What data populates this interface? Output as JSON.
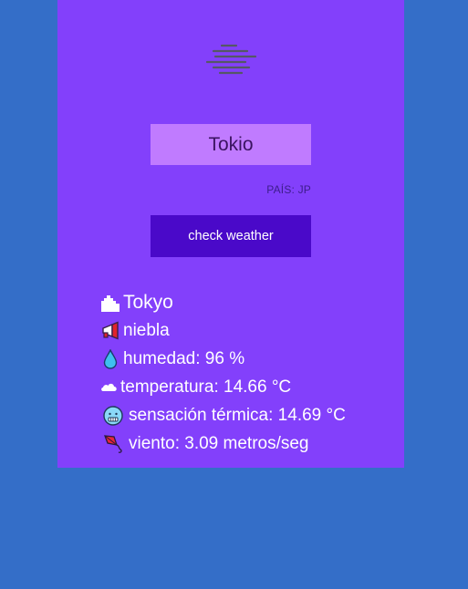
{
  "search": {
    "city_value": "Tokio",
    "country_text": "PAÍS: JP",
    "button_label": "check weather"
  },
  "weather": {
    "icon": "fog-icon",
    "city": "Tokyo",
    "description": "niebla",
    "humidity": "humedad: 96 %",
    "temperature": "temperatura: 14.66 °C",
    "feels_like": "sensación térmica: 14.69 °C",
    "wind": "viento: 3.09 metros/seg"
  },
  "colors": {
    "background": "#346ec8",
    "card": "#8340fb",
    "input": "#c07bff",
    "button": "#4a09c9"
  }
}
